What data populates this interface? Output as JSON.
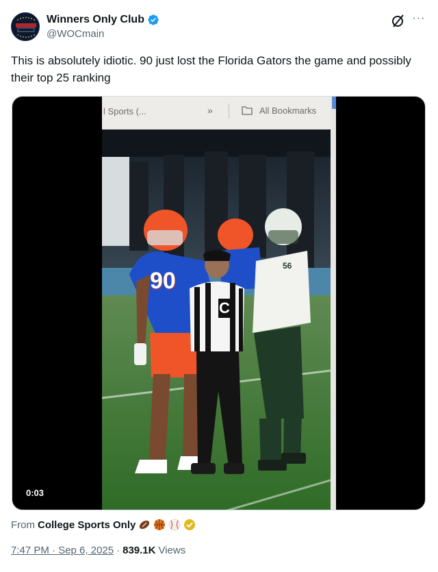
{
  "author": {
    "display_name": "Winners Only Club",
    "handle": "@WOCmain",
    "avatar_text": "WINNERS ONLY"
  },
  "tweet": {
    "text": "This is absolutely idiotic. 90 just lost the Florida Gators the game and possibly their top 25 ranking"
  },
  "media": {
    "duration": "0:03",
    "browser_bar": {
      "tab_text": "l Sports (...",
      "chevron": "»",
      "bookmarks_label": "All Bookmarks"
    },
    "jersey_numbers": {
      "gator": "90",
      "opponent": "56",
      "referee": "C"
    }
  },
  "source": {
    "prefix": "From",
    "name": "College Sports Only"
  },
  "meta": {
    "time": "7:47 PM · Sep 6, 2025",
    "separator": "·",
    "views_count": "839.1K",
    "views_label": "Views"
  },
  "colors": {
    "verified": "#1d9bf0",
    "text": "#0f1419",
    "secondary": "#536471",
    "gator_blue": "#1f4fc8",
    "gator_orange": "#f0552a",
    "field_green": "#3b7a2e"
  }
}
